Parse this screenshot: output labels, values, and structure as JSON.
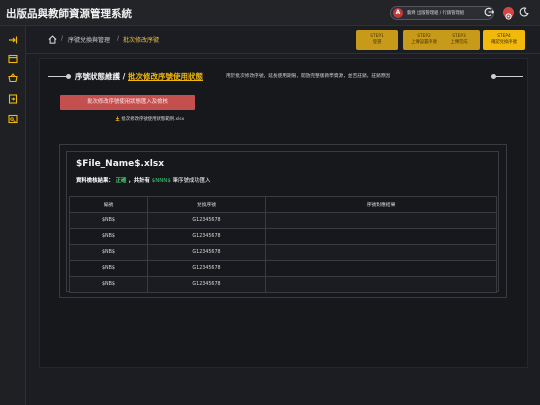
{
  "app_title": "出版品與教師資源管理系統",
  "user": {
    "avatar_letter": "A",
    "label": "藝齊 出版管理組 / 行銷管理組"
  },
  "breadcrumb": {
    "section": "序號兌換與管理",
    "sep1": "/",
    "current": "批次修改序號",
    "sep2": "/"
  },
  "steps": [
    {
      "line1": "STEP1",
      "line2": "登選"
    },
    {
      "line1": "STEP2",
      "line2": "上傳設置序號"
    },
    {
      "line1": "STEP3",
      "line2": "上傳完成"
    },
    {
      "line1": "STEP4",
      "line2": "確認兌換序號"
    }
  ],
  "section": {
    "title_main": "序號狀態維護",
    "title_sep": " / ",
    "title_sub": "批次修改序號使用狀態",
    "description": "用於批次修改序號，延長使用期限，開放完整版教學資源，並否註銷，註銷原因"
  },
  "import_button": "批次修改序號使用狀態匯入及檢核",
  "download_link": "批次修改序號使用狀態範例.xlsx",
  "result": {
    "file_name": "$File_Name$.xlsx",
    "summary_label": "資料檢核結果：",
    "summary_status": "正確",
    "summary_middle": "，共計有",
    "summary_count": "$NNN$",
    "summary_tail": "筆序號成功匯入"
  },
  "table": {
    "headers": [
      "編號",
      "兌換序號",
      "序號對應結果"
    ],
    "rows": [
      [
        "$NB$",
        "G12345678",
        ""
      ],
      [
        "$NB$",
        "G12345678",
        ""
      ],
      [
        "$NB$",
        "G12345678",
        ""
      ],
      [
        "$NB$",
        "G12345678",
        ""
      ],
      [
        "$NB$",
        "G12345678",
        ""
      ]
    ]
  },
  "colors": {
    "accent": "#f0b90b",
    "step": "#c79a1a",
    "danger_button": "#c44f4f",
    "success": "#3ed16b"
  },
  "icons": {
    "sidebar": [
      "sign-in-icon",
      "window-icon",
      "shopping-basket-icon",
      "import-icon",
      "serial-card-icon"
    ],
    "header": [
      "avatar-icon",
      "logout-icon",
      "settings-icon",
      "theme-moon-icon"
    ]
  }
}
